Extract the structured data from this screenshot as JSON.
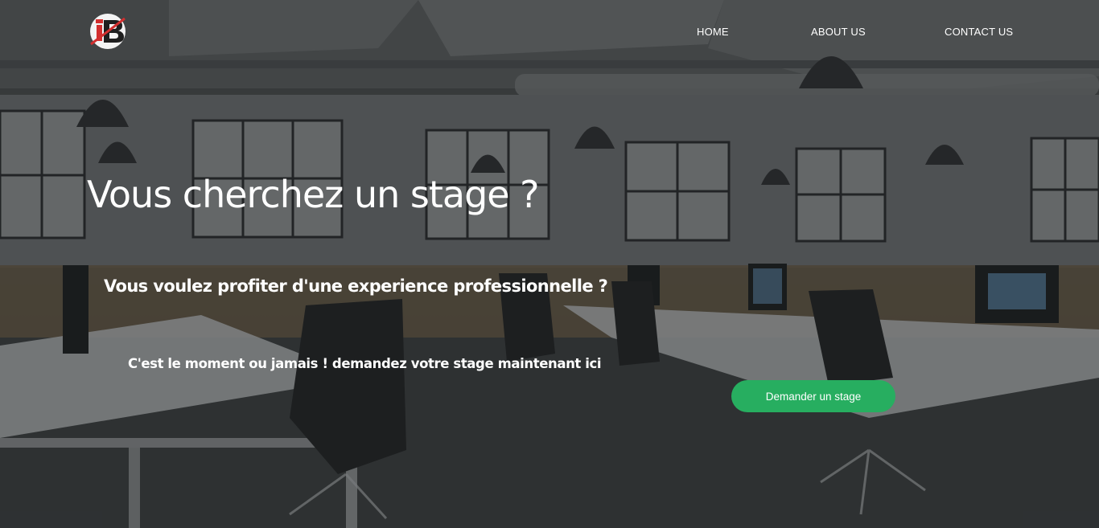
{
  "header": {
    "logo_text": "iB",
    "nav": [
      {
        "label": "HOME"
      },
      {
        "label": "ABOUT US"
      },
      {
        "label": "CONTACT US"
      }
    ]
  },
  "hero": {
    "title": "Vous cherchez un stage ?",
    "subtitle": "Vous voulez profiter d'une experience professionnelle ?",
    "tagline": "C'est le moment ou jamais ! demandez votre stage maintenant ici",
    "cta_label": "Demander un stage",
    "background": "office-interior-photo"
  },
  "colors": {
    "accent": "#27ae60",
    "logo_red": "#d32f2f",
    "text": "#ffffff"
  }
}
